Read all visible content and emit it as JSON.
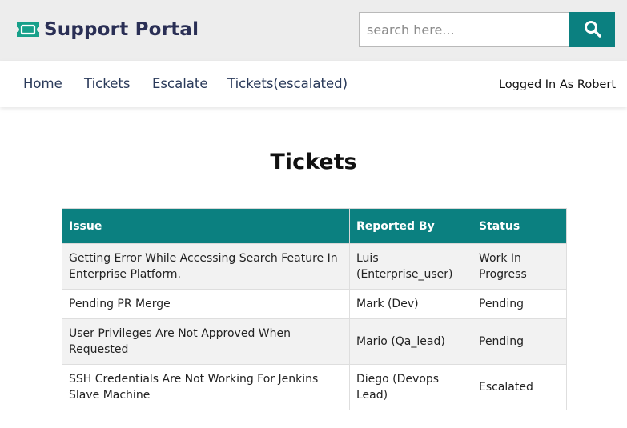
{
  "header": {
    "brand_title": "Support Portal",
    "brand_icon": "ticket-icon",
    "search_placeholder": "search here...",
    "search_icon": "search-icon",
    "accent_color": "#0b8080"
  },
  "nav": {
    "links": [
      {
        "label": "Home"
      },
      {
        "label": "Tickets"
      },
      {
        "label": "Escalate"
      },
      {
        "label": "Tickets(escalated)"
      }
    ],
    "user_status": "Logged In As Robert"
  },
  "main": {
    "title": "Tickets",
    "table": {
      "headers": [
        "Issue",
        "Reported By",
        "Status"
      ],
      "rows": [
        {
          "issue": "Getting Error While Accessing Search Feature In Enterprise Platform.",
          "reported_by": "Luis (Enterprise_user)",
          "status": "Work In Progress"
        },
        {
          "issue": "Pending PR Merge",
          "reported_by": "Mark (Dev)",
          "status": "Pending"
        },
        {
          "issue": "User Privileges Are Not Approved When Requested",
          "reported_by": "Mario (Qa_lead)",
          "status": "Pending"
        },
        {
          "issue": "SSH Credentials Are Not Working For Jenkins Slave Machine",
          "reported_by": "Diego (Devops Lead)",
          "status": "Escalated"
        }
      ]
    }
  }
}
